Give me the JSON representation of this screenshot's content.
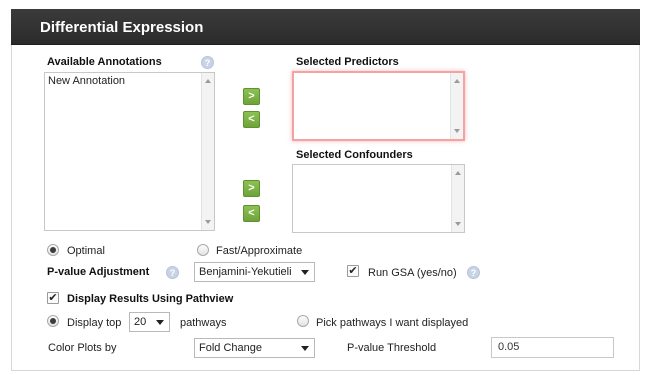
{
  "header": {
    "title": "Differential Expression"
  },
  "annotations": {
    "label": "Available Annotations",
    "help": "?",
    "items": [
      "New Annotation"
    ]
  },
  "predictors": {
    "label": "Selected Predictors",
    "add": ">",
    "remove": "<"
  },
  "confounders": {
    "label": "Selected Confounders",
    "add": ">",
    "remove": "<"
  },
  "method": {
    "optimal_label": "Optimal",
    "fast_label": "Fast/Approximate",
    "selected": "Optimal"
  },
  "pvalue_adjustment": {
    "label": "P-value Adjustment",
    "help": "?",
    "value": "Benjamini-Yekutieli"
  },
  "run_gsa": {
    "label": "Run GSA (yes/no)",
    "help": "?",
    "checked": true,
    "mark": "✔"
  },
  "display_pathview": {
    "label": "Display Results Using Pathview",
    "checked": true,
    "mark": "✔"
  },
  "pathways": {
    "top_label": "Display top",
    "top_value": "20",
    "top_suffix": "pathways",
    "pick_label": "Pick pathways I want displayed",
    "selected": "Display top"
  },
  "color_plots": {
    "label": "Color Plots by",
    "value": "Fold Change"
  },
  "pvalue_threshold": {
    "label": "P-value Threshold",
    "value": "0.05"
  },
  "colors": {
    "header_bg": "#2f2f2f",
    "button_green": "#7cb342",
    "highlight_border": "#f2a3a3"
  }
}
